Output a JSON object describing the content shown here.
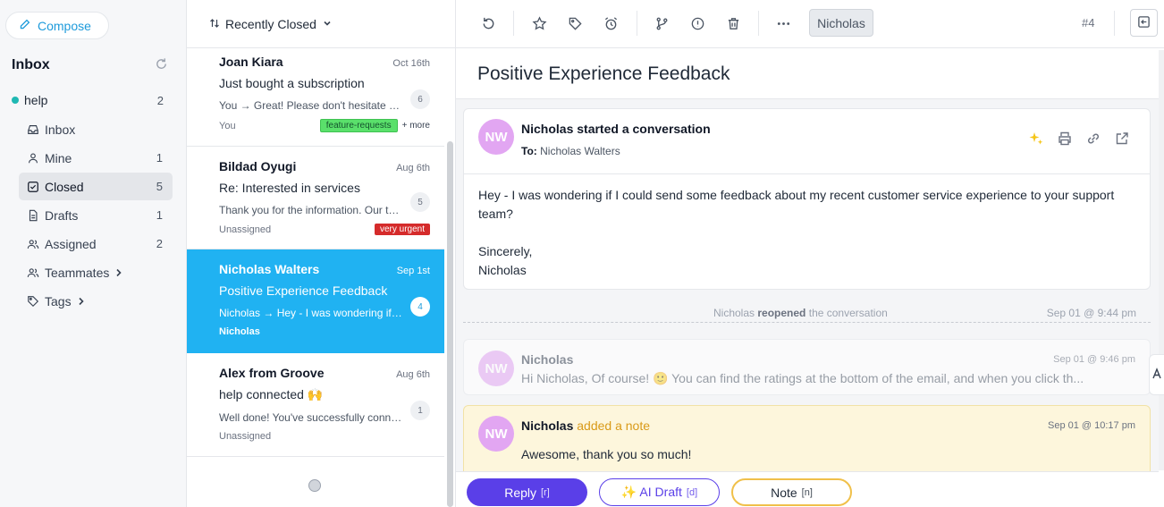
{
  "sidebar": {
    "compose_label": "Compose",
    "inbox_title": "Inbox",
    "mailbox": {
      "name": "help",
      "count": "2"
    },
    "items": [
      {
        "label": "Inbox",
        "count": ""
      },
      {
        "label": "Mine",
        "count": "1"
      },
      {
        "label": "Closed",
        "count": "5"
      },
      {
        "label": "Drafts",
        "count": "1"
      },
      {
        "label": "Assigned",
        "count": "2"
      },
      {
        "label": "Teammates",
        "count": ""
      },
      {
        "label": "Tags",
        "count": ""
      }
    ]
  },
  "list": {
    "sort_label": "Recently Closed",
    "conversations": [
      {
        "name": "Joan Kiara",
        "date": "Oct 16th",
        "subject": "Just bought a subscription",
        "preview": "You → Great! Please don't hesitate to reach out",
        "count": "6",
        "assignee": "You",
        "tag": "feature-requests",
        "more": "+ more"
      },
      {
        "name": "Bildad Oyugi",
        "date": "Aug 6th",
        "subject": "Re: Interested in services",
        "preview": "Thank you for the information.  Our team will",
        "count": "5",
        "assignee": "Unassigned",
        "tag": "very urgent"
      },
      {
        "name": "Nicholas Walters",
        "date": "Sep 1st",
        "subject": "Positive Experience Feedback",
        "preview": "Nicholas → Hey - I was wondering if I could",
        "count": "4",
        "assignee": "Nicholas"
      },
      {
        "name": "Alex from Groove",
        "date": "Aug 6th",
        "subject": "help connected 🙌",
        "preview": "Well done! You've successfully connected your",
        "count": "1",
        "assignee": "Unassigned"
      }
    ]
  },
  "toolbar": {
    "assignee": "Nicholas",
    "conversation_number": "#4"
  },
  "detail": {
    "subject": "Positive Experience Feedback",
    "first_message": {
      "avatar": "NW",
      "header": "Nicholas started a conversation",
      "to_label": "To:",
      "to_value": "Nicholas Walters",
      "body_line1": "Hey - I was wondering if I could send some feedback about my recent customer service experience to your support team?",
      "signoff": "Sincerely,",
      "signature": "Nicholas"
    },
    "event": {
      "actor": "Nicholas",
      "action": "reopened",
      "rest": "the conversation",
      "timestamp": "Sep 01 @ 9:44 pm"
    },
    "reply_message": {
      "avatar": "NW",
      "author": "Nicholas",
      "timestamp": "Sep 01 @ 9:46 pm",
      "snippet": "Hi Nicholas,   Of course! 🙂 You can find the ratings at the bottom of the email, and when you click th..."
    },
    "note": {
      "avatar": "NW",
      "author": "Nicholas",
      "action": "added a note",
      "timestamp": "Sep 01 @ 10:17 pm",
      "text": "Awesome, thank you so much!"
    }
  },
  "reply_bar": {
    "reply_label": "Reply",
    "reply_key": "[r]",
    "ai_label": "✨ AI Draft",
    "ai_key": "[d]",
    "note_label": "Note",
    "note_key": "[n]"
  },
  "colors": {
    "accent": "#20b2f2",
    "primary_button": "#5a3fe8",
    "note_background": "#fdf6dc",
    "tag_green": "#5ae06b",
    "tag_red": "#d52b2b",
    "avatar": "#e2a6f2"
  }
}
